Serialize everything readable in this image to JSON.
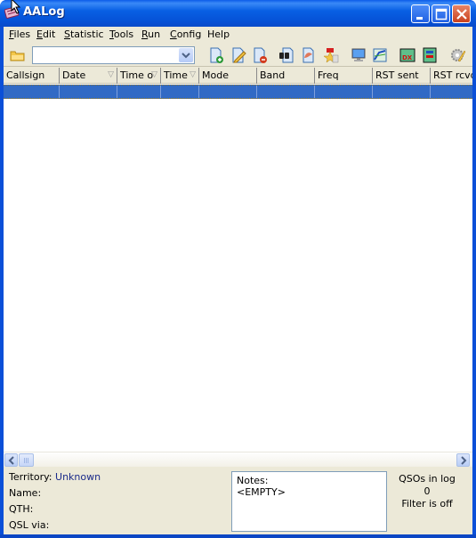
{
  "window": {
    "title": "AALog"
  },
  "menu": [
    {
      "label": "Files",
      "accel": "F",
      "rest": "iles"
    },
    {
      "label": "Edit",
      "accel": "E",
      "rest": "dit"
    },
    {
      "label": "Statistic",
      "accel": "S",
      "rest": "tatistic"
    },
    {
      "label": "Tools",
      "accel": "T",
      "rest": "ools"
    },
    {
      "label": "Run",
      "accel": "R",
      "rest": "un"
    },
    {
      "label": "Config",
      "accel": "C",
      "rest": "onfig"
    },
    {
      "label": "Help",
      "accel": "",
      "rest": "Help"
    }
  ],
  "toolbar": {
    "combo_value": "",
    "icons": [
      "open-folder-icon",
      "new-qso-icon",
      "edit-qso-icon",
      "delete-qso-icon",
      "find-qso-icon",
      "qsl-icon",
      "award-icon",
      "cluster-monitor-icon",
      "band-map-icon",
      "dx-icon",
      "propagation-icon",
      "settings-icon"
    ]
  },
  "grid": {
    "columns": [
      {
        "label": "Callsign",
        "sort": false
      },
      {
        "label": "Date",
        "sort": true
      },
      {
        "label": "Time o",
        "sort": true
      },
      {
        "label": "Time",
        "sort": true
      },
      {
        "label": "Mode",
        "sort": false
      },
      {
        "label": "Band",
        "sort": false
      },
      {
        "label": "Freq",
        "sort": false
      },
      {
        "label": "RST sent",
        "sort": false
      },
      {
        "label": "RST rcvd",
        "sort": false
      }
    ],
    "sort_glyph": "▽",
    "rows": [
      {
        "selected": true,
        "cells": [
          "",
          "",
          "",
          "",
          "",
          "",
          "",
          "",
          ""
        ]
      }
    ]
  },
  "info": {
    "territory_label": "Territory:",
    "territory_value": "Unknown",
    "name_label": "Name:",
    "qth_label": "QTH:",
    "qsl_label": "QSL via:",
    "notes_label": "Notes:",
    "notes_value": "<EMPTY>",
    "qsos_label": "QSOs in log",
    "qsos_count": "0",
    "filter_status": "Filter is off"
  }
}
